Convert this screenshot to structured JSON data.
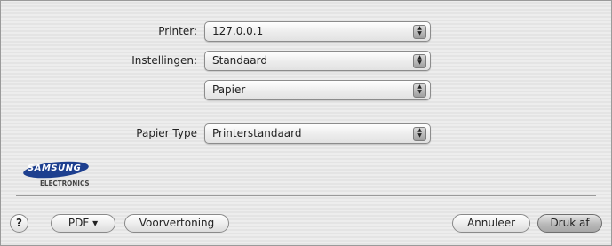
{
  "form": {
    "printer": {
      "label": "Printer:",
      "value": "127.0.0.1"
    },
    "presets": {
      "label": "Instellingen:",
      "value": "Standaard"
    },
    "panel": {
      "value": "Papier"
    },
    "paper_type": {
      "label": "Papier Type",
      "value": "Printerstandaard"
    }
  },
  "logo": {
    "brand": "SAMSUNG",
    "subtitle": "ELECTRONICS"
  },
  "buttons": {
    "help": "?",
    "pdf": "PDF ▾",
    "preview": "Voorvertoning",
    "cancel": "Annuleer",
    "print": "Druk af"
  },
  "colors": {
    "logo_blue": "#1d3f8f",
    "background": "#e9e9e9"
  }
}
